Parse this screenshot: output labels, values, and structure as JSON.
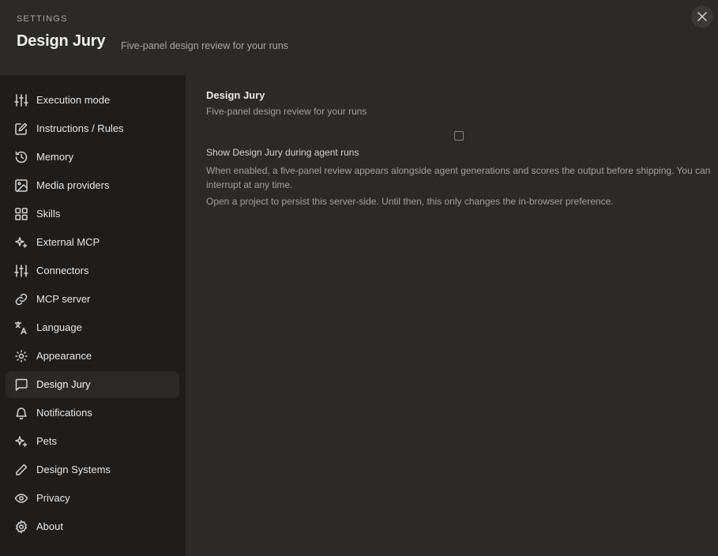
{
  "header": {
    "kicker": "SETTINGS",
    "title": "Design Jury",
    "subtitle": "Five-panel design review for your runs"
  },
  "sidebar": {
    "items": [
      {
        "label": "Execution mode",
        "icon": "sliders-icon"
      },
      {
        "label": "Instructions / Rules",
        "icon": "edit-icon"
      },
      {
        "label": "Memory",
        "icon": "history-icon"
      },
      {
        "label": "Media providers",
        "icon": "image-icon"
      },
      {
        "label": "Skills",
        "icon": "grid-icon"
      },
      {
        "label": "External MCP",
        "icon": "sparkle-icon"
      },
      {
        "label": "Connectors",
        "icon": "sliders-icon"
      },
      {
        "label": "MCP server",
        "icon": "link-icon"
      },
      {
        "label": "Language",
        "icon": "translate-icon"
      },
      {
        "label": "Appearance",
        "icon": "sun-icon"
      },
      {
        "label": "Design Jury",
        "icon": "message-icon",
        "active": true
      },
      {
        "label": "Notifications",
        "icon": "bell-icon"
      },
      {
        "label": "Pets",
        "icon": "sparkle-icon"
      },
      {
        "label": "Design Systems",
        "icon": "pencil-icon"
      },
      {
        "label": "Privacy",
        "icon": "eye-icon"
      },
      {
        "label": "About",
        "icon": "gear-icon"
      }
    ]
  },
  "main": {
    "section_title": "Design Jury",
    "section_subtitle": "Five-panel design review for your runs",
    "option": {
      "label": "Show Design Jury during agent runs",
      "checked": false,
      "description": "When enabled, a five-panel review appears alongside agent generations and scores the output before shipping. You can interrupt at any time.",
      "note": "Open a project to persist this server-side. Until then, this only changes the in-browser preference."
    }
  },
  "colors": {
    "background": "#2b2a28",
    "sidebar": "#1e1d1c",
    "active_item": "#2a2927",
    "text": "#e9e7e3",
    "muted": "#a3a09a"
  }
}
